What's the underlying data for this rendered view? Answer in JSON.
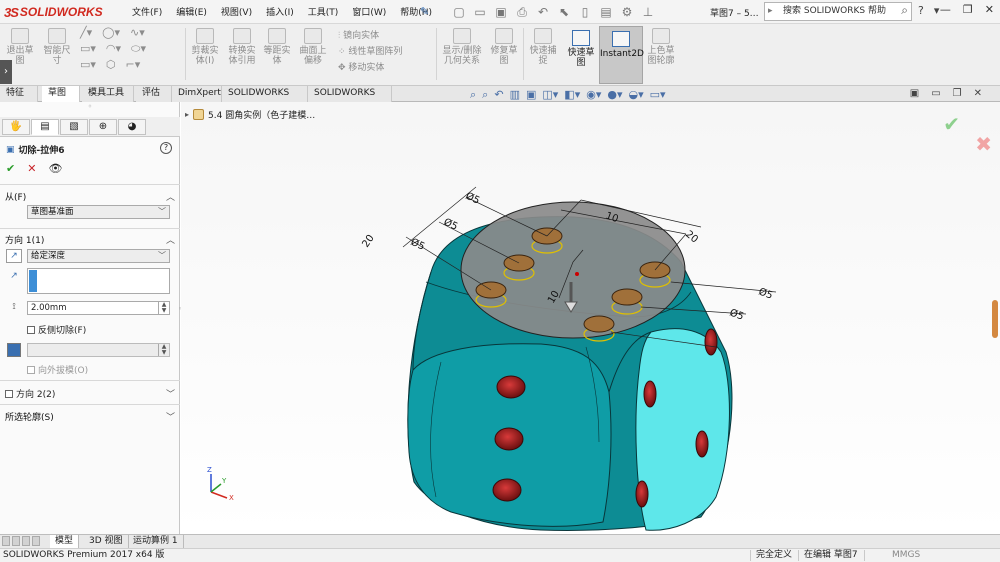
{
  "app": {
    "logo_prefix": "3S",
    "logo_text": "SOLIDWORKS",
    "document_name": "草图7 – 5…",
    "window_buttons": [
      "—",
      "❐",
      "✕"
    ]
  },
  "menu": [
    "文件(F)",
    "编辑(E)",
    "视图(V)",
    "插入(I)",
    "工具(T)",
    "窗口(W)",
    "帮助(H)"
  ],
  "search": {
    "placeholder": "搜索 SOLIDWORKS 帮助"
  },
  "help": {
    "q": "?",
    "dd": "▾"
  },
  "ribbon": {
    "items": [
      {
        "label": "退出草\n图"
      },
      {
        "label": "智能尺\n寸"
      },
      {
        "label": "剪裁实\n体(I)"
      },
      {
        "label": "转换实\n体引用"
      },
      {
        "label": "等距实\n体"
      },
      {
        "label": "曲面上\n偏移"
      },
      {
        "label": "镜向实体"
      },
      {
        "label": "线性草图阵列"
      },
      {
        "label": "移动实体"
      },
      {
        "label": "显示/删除\n几何关系"
      },
      {
        "label": "修复草\n图"
      },
      {
        "label": "快速捕\n捉"
      },
      {
        "label": "上色草\n图轮廓"
      }
    ],
    "fast_sketch": "快速草\n图",
    "instant2d": "Instant2D"
  },
  "tabs": [
    "特征",
    "草图",
    "模具工具",
    "评估",
    "DimXpert",
    "SOLIDWORKS 插件",
    "SOLIDWORKS MBD"
  ],
  "property_manager": {
    "title": "切除-拉伸6",
    "help": "?",
    "from_label": "从(F)",
    "from_value": "草图基准面",
    "direction1_label": "方向 1(1)",
    "end_condition": "给定深度",
    "depth": "2.00mm",
    "flip_side": "反侧切除(F)",
    "draft_outward": "向外拔模(O)",
    "direction2_label": "方向 2(2)",
    "selected_contours": "所选轮廓(S)"
  },
  "tree": {
    "item": "5.4 圆角实例（色子建模…"
  },
  "dimensions": [
    "Ø5",
    "Ø5",
    "Ø5",
    "10",
    "20",
    "20",
    "10",
    "Ø5",
    "Ø5"
  ],
  "axes": {
    "x": "X",
    "y": "Y",
    "z": "Z"
  },
  "bottom_tabs": [
    "模型",
    "3D 视图",
    "运动算例 1"
  ],
  "status": {
    "product": "SOLIDWORKS Premium 2017 x64 版",
    "defined": "完全定义",
    "editing": "在编辑 草图7",
    "units": "MMGS"
  },
  "colors": {
    "die_body": "#0d8c94",
    "die_light_face": "#5ee7ea",
    "pip": "#a81c1c",
    "sketch_face": "#8a8a8a",
    "accent": "#3a6fb0"
  }
}
